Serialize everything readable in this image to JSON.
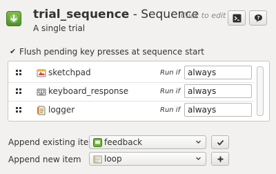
{
  "header": {
    "name": "trial_sequence",
    "separator": " - ",
    "type": "Sequence",
    "description": "A single trial",
    "click_to_edit": "Click to edit"
  },
  "flush": {
    "checked": true,
    "label": "Flush pending key presses at sequence start"
  },
  "items": [
    {
      "name": "sketchpad",
      "icon": "sketchpad-icon",
      "run_if_label": "Run if",
      "run_if": "always"
    },
    {
      "name": "keyboard_response",
      "icon": "keyboard-icon",
      "run_if_label": "Run if",
      "run_if": "always"
    },
    {
      "name": "logger",
      "icon": "logger-icon",
      "run_if_label": "Run if",
      "run_if": "always"
    }
  ],
  "append_existing": {
    "label": "Append existing item",
    "value": "feedback",
    "icon": "feedback-icon"
  },
  "append_new": {
    "label": "Append new item",
    "value": "loop",
    "icon": "loop-icon"
  },
  "colors": {
    "accent_green": "#5a9e2f",
    "background": "#f2f1f0"
  }
}
